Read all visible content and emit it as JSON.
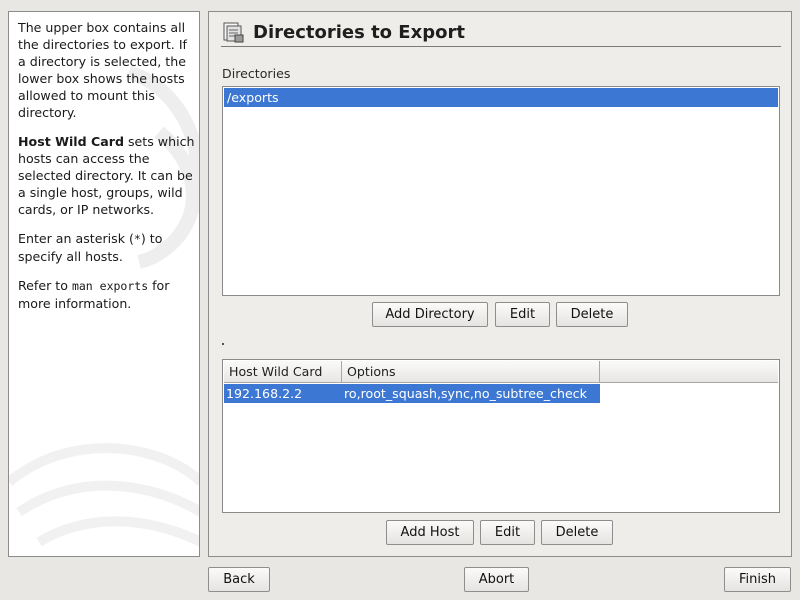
{
  "help": {
    "p1": "The upper box contains all the directories to export. If a directory is selected, the lower box shows the hosts allowed to mount this directory.",
    "p2_bold": "Host Wild Card",
    "p2_rest": " sets which hosts can access the selected directory. It can be a single host, groups, wild cards, or IP networks.",
    "p3_a": "Enter an asterisk (",
    "p3_code": "*",
    "p3_b": ") to specify all hosts.",
    "p4_a": "Refer to ",
    "p4_code": "man exports",
    "p4_b": " for more information."
  },
  "header": {
    "title": "Directories to Export",
    "icon": "export-folder-icon"
  },
  "directories": {
    "label": "Directories",
    "items": [
      "/exports"
    ],
    "selected": 0
  },
  "dir_buttons": {
    "add": "Add Directory",
    "edit": "Edit",
    "delete": "Delete"
  },
  "hosts": {
    "columns": [
      "Host Wild Card",
      "Options"
    ],
    "rows": [
      {
        "host": "192.168.2.2",
        "options": "ro,root_squash,sync,no_subtree_check"
      }
    ]
  },
  "host_buttons": {
    "add": "Add Host",
    "edit": "Edit",
    "delete": "Delete"
  },
  "footer": {
    "back": "Back",
    "abort": "Abort",
    "finish": "Finish"
  },
  "colors": {
    "selection": "#3c78d3",
    "background": "#e9e7e3"
  }
}
